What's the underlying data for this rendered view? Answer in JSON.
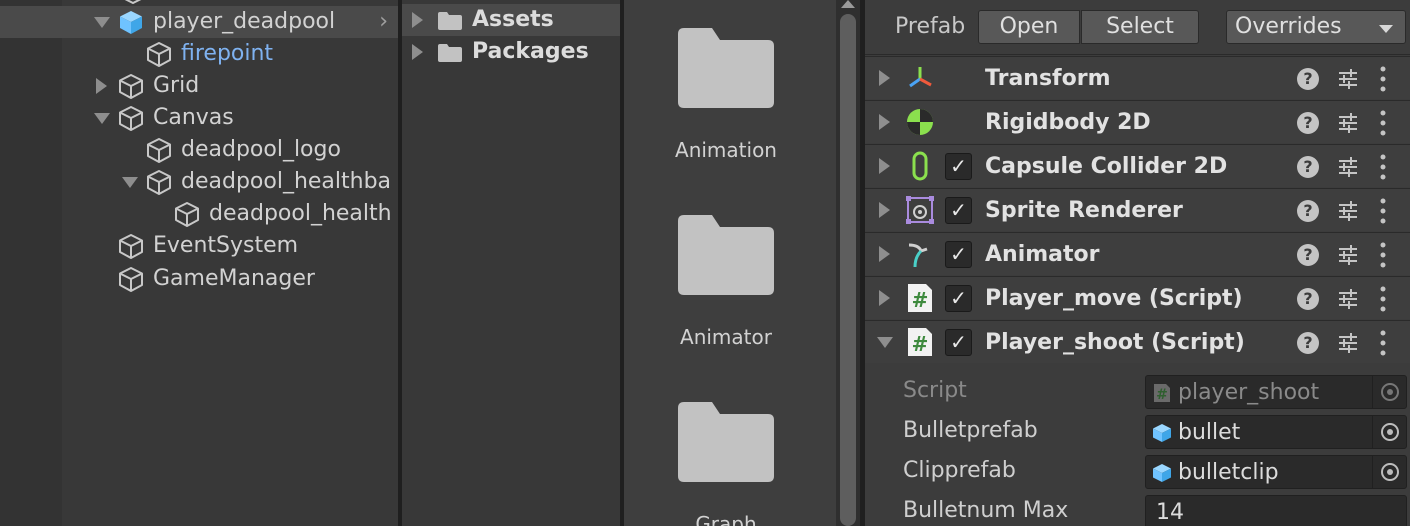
{
  "hierarchy": {
    "items": [
      {
        "label": "player_deadpool",
        "selected": true
      },
      {
        "label": "firepoint"
      },
      {
        "label": "Grid"
      },
      {
        "label": "Canvas"
      },
      {
        "label": "deadpool_logo"
      },
      {
        "label": "deadpool_healthba"
      },
      {
        "label": "deadpool_health"
      },
      {
        "label": "EventSystem"
      },
      {
        "label": "GameManager"
      }
    ],
    "chevron": "›"
  },
  "project": {
    "tree": [
      {
        "label": "Assets",
        "selected": true
      },
      {
        "label": "Packages"
      }
    ],
    "folders": [
      {
        "label": "Animation"
      },
      {
        "label": "Animator"
      },
      {
        "label": "Graph"
      }
    ]
  },
  "inspector": {
    "prefab": {
      "label": "Prefab",
      "open_label": "Open",
      "select_label": "Select",
      "overrides_label": "Overrides"
    },
    "components": [
      {
        "name": "Transform",
        "icon": "transform-icon",
        "has_checkbox": false
      },
      {
        "name": "Rigidbody 2D",
        "icon": "rigidbody-icon",
        "has_checkbox": false
      },
      {
        "name": "Capsule Collider 2D",
        "icon": "capsule-collider-icon",
        "has_checkbox": true,
        "checked": true
      },
      {
        "name": "Sprite Renderer",
        "icon": "sprite-renderer-icon",
        "has_checkbox": true,
        "checked": true
      },
      {
        "name": "Animator",
        "icon": "animator-icon",
        "has_checkbox": true,
        "checked": true
      },
      {
        "name": "Player_move (Script)",
        "icon": "script-icon",
        "has_checkbox": true,
        "checked": true
      },
      {
        "name": "Player_shoot (Script)",
        "icon": "script-icon",
        "has_checkbox": true,
        "checked": true,
        "expanded": true
      }
    ],
    "help_glyph": "?",
    "check_glyph": "✓",
    "fields": {
      "script": {
        "label": "Script",
        "value": "player_shoot"
      },
      "bulletprefab": {
        "label": "Bulletprefab",
        "value": "bullet"
      },
      "clipprefab": {
        "label": "Clipprefab",
        "value": "bulletclip"
      },
      "bulletnum_max": {
        "label": "Bulletnum Max",
        "value": "14"
      }
    }
  },
  "colors": {
    "link": "#7fb2f0",
    "prefab_cube": "#6fc3ff",
    "script_hash": "#3e8a3e",
    "collider_green": "#8be04e"
  }
}
